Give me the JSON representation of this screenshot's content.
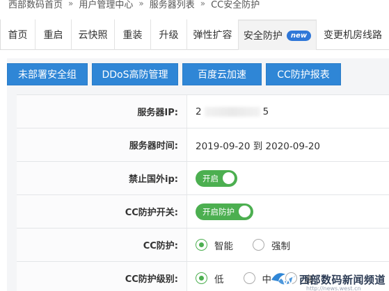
{
  "breadcrumb": {
    "items": [
      "西部数码首页",
      "用户管理中心",
      "服务器列表",
      "CC安全防护"
    ],
    "separator": "»"
  },
  "tabs": [
    {
      "label": "首页"
    },
    {
      "label": "重启"
    },
    {
      "label": "云快照"
    },
    {
      "label": "重装"
    },
    {
      "label": "升级"
    },
    {
      "label": "弹性扩容"
    },
    {
      "label": "安全防护",
      "badge": "new",
      "active": true
    },
    {
      "label": "变更机房线路"
    }
  ],
  "buttons": [
    "未部署安全组",
    "DDoS高防管理",
    "百度云加速",
    "CC防护报表"
  ],
  "form": {
    "server_ip": {
      "label": "服务器IP:",
      "prefix": "2",
      "suffix": "5"
    },
    "server_time": {
      "label": "服务器时间:",
      "value": "2019-09-20 到 2020-09-20"
    },
    "block_foreign_ip": {
      "label": "禁止国外ip:",
      "toggle": "开启"
    },
    "cc_switch": {
      "label": "CC防护开关:",
      "toggle": "开启防护"
    },
    "cc_mode": {
      "label": "CC防护:",
      "options": [
        "智能",
        "强制"
      ],
      "selected": "智能"
    },
    "cc_level": {
      "label": "CC防护级别:",
      "options": [
        "低",
        "中",
        "高"
      ],
      "selected": "低"
    }
  },
  "watermark": {
    "text": "西部数码新闻频道",
    "url": "http://news.west.cn"
  },
  "colors": {
    "primary_button": "#2f86d6",
    "toggle_on": "#4caf50",
    "badge": "#2f77d8"
  }
}
